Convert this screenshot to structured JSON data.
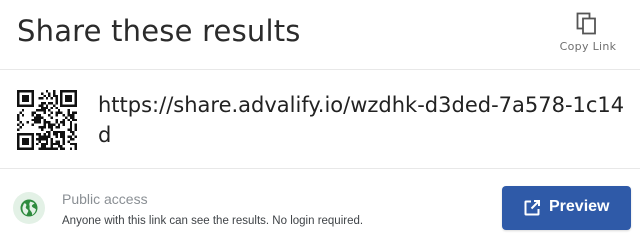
{
  "header": {
    "title": "Share these results",
    "copy_link_label": "Copy Link",
    "copy_icon": "copy-icon"
  },
  "share": {
    "url": "https://share.advalify.io/wzdhk-d3ded-7a578-1c14d",
    "qr_icon": "qr-code"
  },
  "access": {
    "title": "Public access",
    "description": "Anyone with this link can see the results. No login required.",
    "icon": "globe-icon",
    "icon_color": "#2e8b3e",
    "icon_bg": "#e3f1e6"
  },
  "actions": {
    "preview_label": "Preview",
    "preview_icon": "external-link-icon",
    "preview_color": "#2f5aa8"
  }
}
